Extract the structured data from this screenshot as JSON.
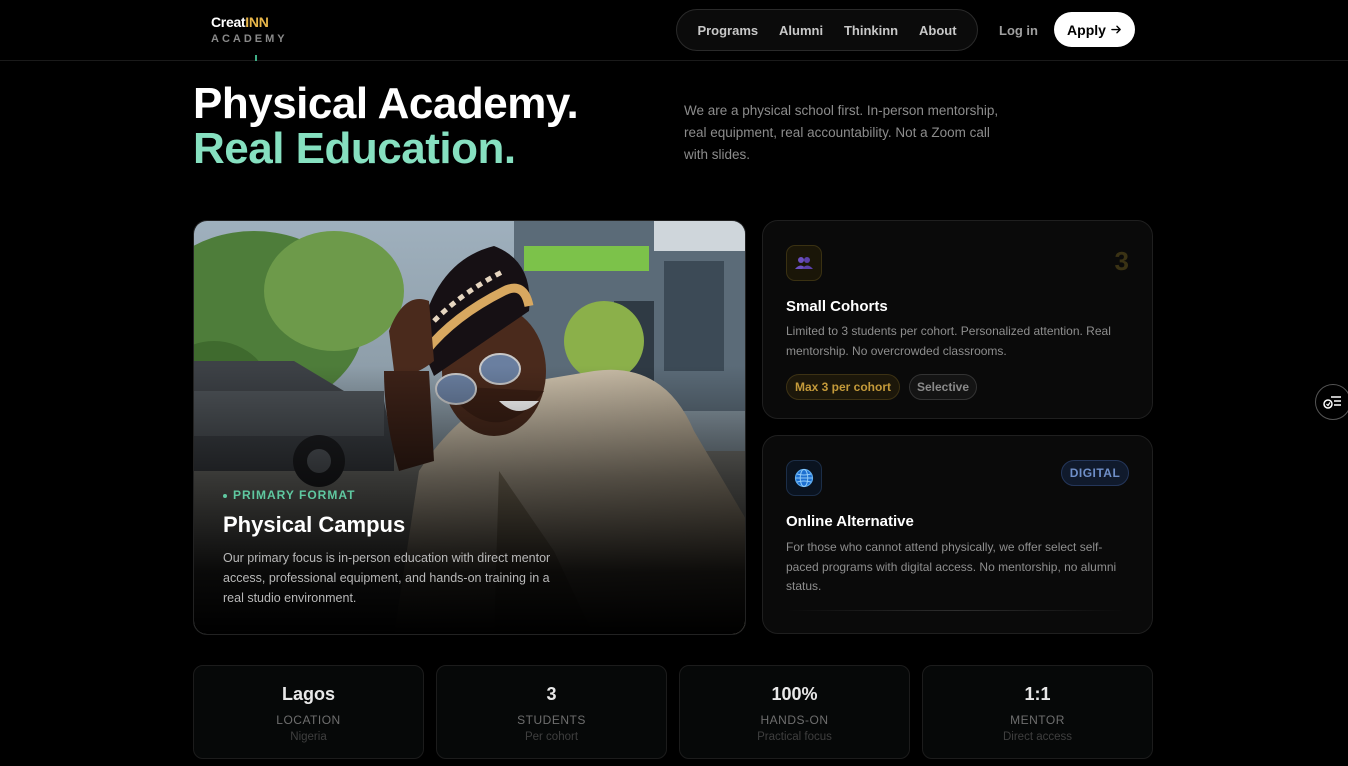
{
  "header": {
    "logo_part1": "Creat",
    "logo_part2": "INN",
    "logo_sub": "ACADEMY",
    "nav": [
      "Programs",
      "Alumni",
      "Thinkinn",
      "About"
    ],
    "login": "Log in",
    "apply": "Apply"
  },
  "hero": {
    "title_line1": "Physical Academy.",
    "title_line2": "Real Education.",
    "description": "We are a physical school first. In-person mentorship, real equipment, real accountability. Not a Zoom call with slides."
  },
  "campus": {
    "tag": "PRIMARY FORMAT",
    "title": "Physical Campus",
    "description": "Our primary focus is in-person education with direct mentor access, professional equipment, and hands-on training in a real studio environment."
  },
  "cohorts_card": {
    "number": "3",
    "title": "Small Cohorts",
    "description": "Limited to 3 students per cohort. Personalized attention. Real mentorship. No overcrowded classrooms.",
    "badges": [
      "Max 3 per cohort",
      "Selective"
    ]
  },
  "online_card": {
    "badge": "DIGITAL",
    "title": "Online Alternative",
    "description": "For those who cannot attend physically, we offer select self-paced programs with digital access. No mentorship, no alumni status."
  },
  "stats": [
    {
      "value": "Lagos",
      "label": "LOCATION",
      "sub": "Nigeria"
    },
    {
      "value": "3",
      "label": "STUDENTS",
      "sub": "Per cohort"
    },
    {
      "value": "100%",
      "label": "HANDS-ON",
      "sub": "Practical focus"
    },
    {
      "value": "1:1",
      "label": "MENTOR",
      "sub": "Direct access"
    }
  ],
  "colors": {
    "accent_green": "#86e0c0",
    "accent_gold": "#e8b64a",
    "digital_blue": "#6f8fc8"
  },
  "icons": {
    "cohort": "users-icon",
    "online": "globe-icon",
    "apply_arrow": "arrow-right-icon",
    "widget": "accessibility-menu-icon"
  }
}
